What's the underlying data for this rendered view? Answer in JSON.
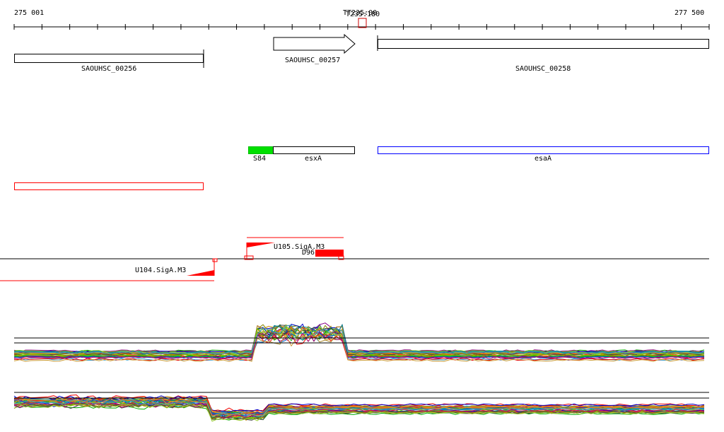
{
  "ruler": {
    "start": "275 001",
    "end": "277 500",
    "marker_a": "TT235:00",
    "marker_b": "T235:180"
  },
  "genes": [
    {
      "name": "SAOUHSC_00256"
    },
    {
      "name": "SAOUHSC_00257"
    },
    {
      "name": "SAOUHSC_00258"
    }
  ],
  "features": {
    "s84": "S84",
    "esxA": "esxA",
    "esaA": "esaA"
  },
  "promoters": {
    "u105": "U105.SigA.M3",
    "u104": "U104.SigA.M3",
    "d96": "D96"
  },
  "colors": {
    "red": "#ff0000",
    "green": "#00e000",
    "blue": "#0000ff"
  }
}
